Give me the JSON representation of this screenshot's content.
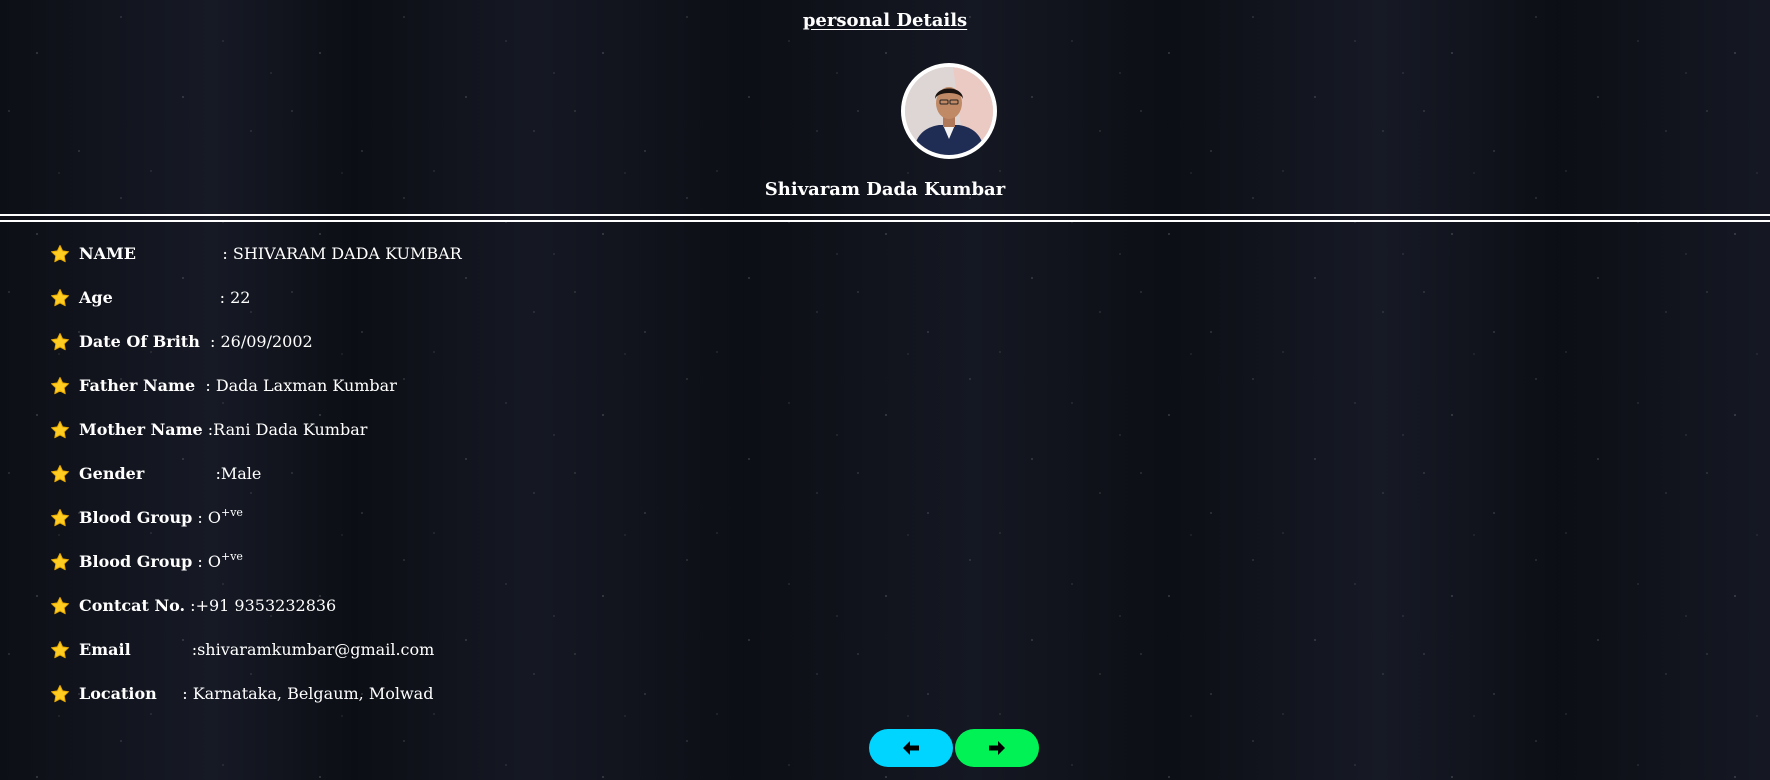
{
  "page_title": "personal Details",
  "profile": {
    "name": "Shivaram Dada Kumbar",
    "avatar_icon": "profile-photo"
  },
  "details": [
    {
      "label": "NAME",
      "sep": "                 : ",
      "value": "SHIVARAM DADA KUMBAR",
      "sup": ""
    },
    {
      "label": "Age",
      "sep": "                     : ",
      "value": "22",
      "sup": ""
    },
    {
      "label": "Date Of Brith",
      "sep": "  : ",
      "value": "26/09/2002",
      "sup": ""
    },
    {
      "label": "Father Name",
      "sep": "  : ",
      "value": "Dada Laxman Kumbar",
      "sup": ""
    },
    {
      "label": "Mother Name",
      "sep": " :",
      "value": "Rani Dada Kumbar",
      "sup": ""
    },
    {
      "label": "Gender",
      "sep": "              :",
      "value": "Male",
      "sup": ""
    },
    {
      "label": "Blood Group",
      "sep": " : ",
      "value": "O",
      "sup": "+ve"
    },
    {
      "label": "Blood Group",
      "sep": " : ",
      "value": "O",
      "sup": "+ve"
    },
    {
      "label": "Contcat No.",
      "sep": " :",
      "value": "+91 9353232836",
      "sup": ""
    },
    {
      "label": "Email",
      "sep": "            :",
      "value": "shivaramkumbar@gmail.com",
      "sup": ""
    },
    {
      "label": "Location",
      "sep": "     : ",
      "value": "Karnataka, Belgaum, Molwad",
      "sup": ""
    }
  ],
  "nav": {
    "prev_icon": "arrow-left-icon",
    "next_icon": "arrow-right-icon",
    "prev_color": "#00d5ff",
    "next_color": "#00f255"
  },
  "colors": {
    "background": "#0d0f16",
    "star": "#ffcc22",
    "text": "#ffffff"
  }
}
